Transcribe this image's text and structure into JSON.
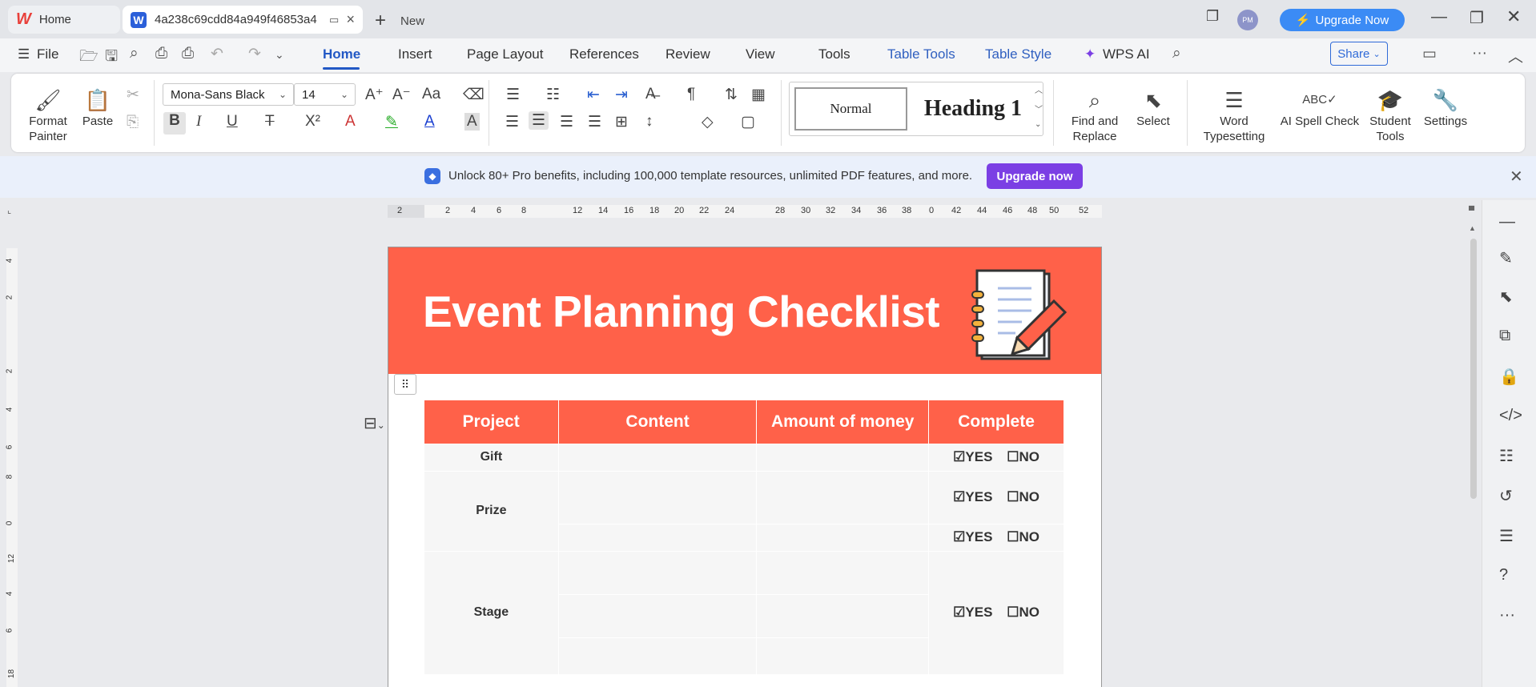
{
  "tabs": {
    "home": "Home",
    "doc": "4a238c69cdd84a949f46853a4",
    "new": "New"
  },
  "titlebar": {
    "avatar": "PM",
    "upgrade": "Upgrade Now"
  },
  "menu": {
    "file": "File",
    "items": [
      "Home",
      "Insert",
      "Page Layout",
      "References",
      "Review",
      "View",
      "Tools",
      "Table Tools",
      "Table Style"
    ],
    "wps_ai": "WPS AI",
    "share": "Share"
  },
  "ribbon": {
    "format_painter": [
      "Format",
      "Painter"
    ],
    "paste": "Paste",
    "font_name": "Mona-Sans Black",
    "font_size": "14",
    "style_normal": "Normal",
    "style_heading": "Heading 1",
    "find_replace": [
      "Find and",
      "Replace"
    ],
    "select": "Select",
    "word_typesetting": [
      "Word",
      "Typesetting"
    ],
    "ai_spell": "AI Spell Check",
    "student_tools": [
      "Student",
      "Tools"
    ],
    "settings": "Settings"
  },
  "banner": {
    "text": "Unlock 80+ Pro benefits, including 100,000 template resources, unlimited PDF features, and more.",
    "button": "Upgrade now"
  },
  "ruler_h": [
    "2",
    "2",
    "4",
    "6",
    "8",
    "12",
    "14",
    "16",
    "18",
    "20",
    "22",
    "24",
    "28",
    "30",
    "32",
    "34",
    "36",
    "38",
    "0",
    "42",
    "44",
    "46",
    "48",
    "50",
    "52"
  ],
  "ruler_v": [
    "4",
    "2",
    "2",
    "4",
    "6",
    "8",
    "0",
    "12",
    "4",
    "6",
    "18"
  ],
  "document": {
    "title": "Event Planning Checklist",
    "headers": [
      "Project",
      "Content",
      "Amount of money",
      "Complete"
    ],
    "rows": [
      {
        "project": "Gift",
        "yes": "☑YES",
        "no": "☐NO"
      },
      {
        "project": "Prize",
        "yes": "☑YES",
        "no": "☐NO"
      },
      {
        "project": "",
        "yes": "☑YES",
        "no": "☐NO"
      },
      {
        "project": "Stage",
        "yes": "☑YES",
        "no": "☐NO"
      }
    ]
  },
  "colors": {
    "accent": "#ff6149",
    "brand": "#2258c5",
    "upgrade": "#7b3fe4"
  }
}
